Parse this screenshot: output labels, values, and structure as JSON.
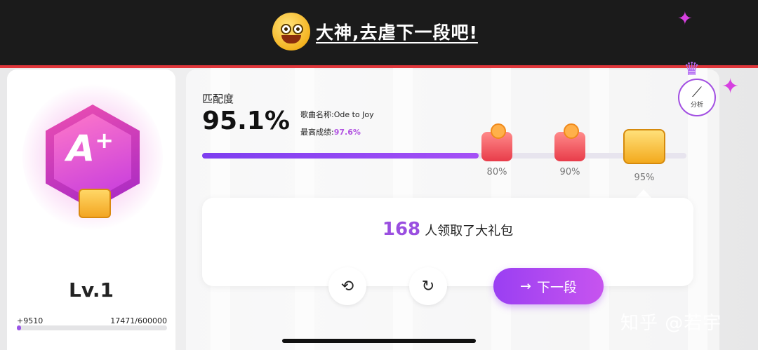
{
  "banner": {
    "text": "大神,去虐下一段吧!",
    "emoji": "grinning-face-icon"
  },
  "left_panel": {
    "grade": "A",
    "grade_suffix": "+",
    "level": "Lv.1",
    "xp_gain": "+9510",
    "xp_progress": "17471/600000",
    "xp_fraction": 0.029
  },
  "main": {
    "match_label": "匹配度",
    "match_value": "95.1%",
    "song_label": "歌曲名称:Ode to Joy",
    "best_label": "最高成绩:",
    "best_value": "97.6%",
    "progress_fraction": 0.951,
    "milestones": [
      {
        "label": "80%",
        "icon": "red-gift-icon"
      },
      {
        "label": "90%",
        "icon": "red-gift-icon"
      },
      {
        "label": "95%",
        "icon": "treasure-chest-icon"
      }
    ],
    "analysis_label": "分析"
  },
  "popup": {
    "claim_count": "168",
    "claim_text": "人领取了大礼包"
  },
  "actions": {
    "back_icon": "undo-icon",
    "retry_icon": "refresh-icon",
    "next_label": "下一段",
    "next_arrow": "→"
  },
  "watermark": "知乎 @若宇",
  "colors": {
    "accent": "#9a3ff2",
    "banner_border": "#e0363b",
    "best_value": "#b255e2"
  }
}
